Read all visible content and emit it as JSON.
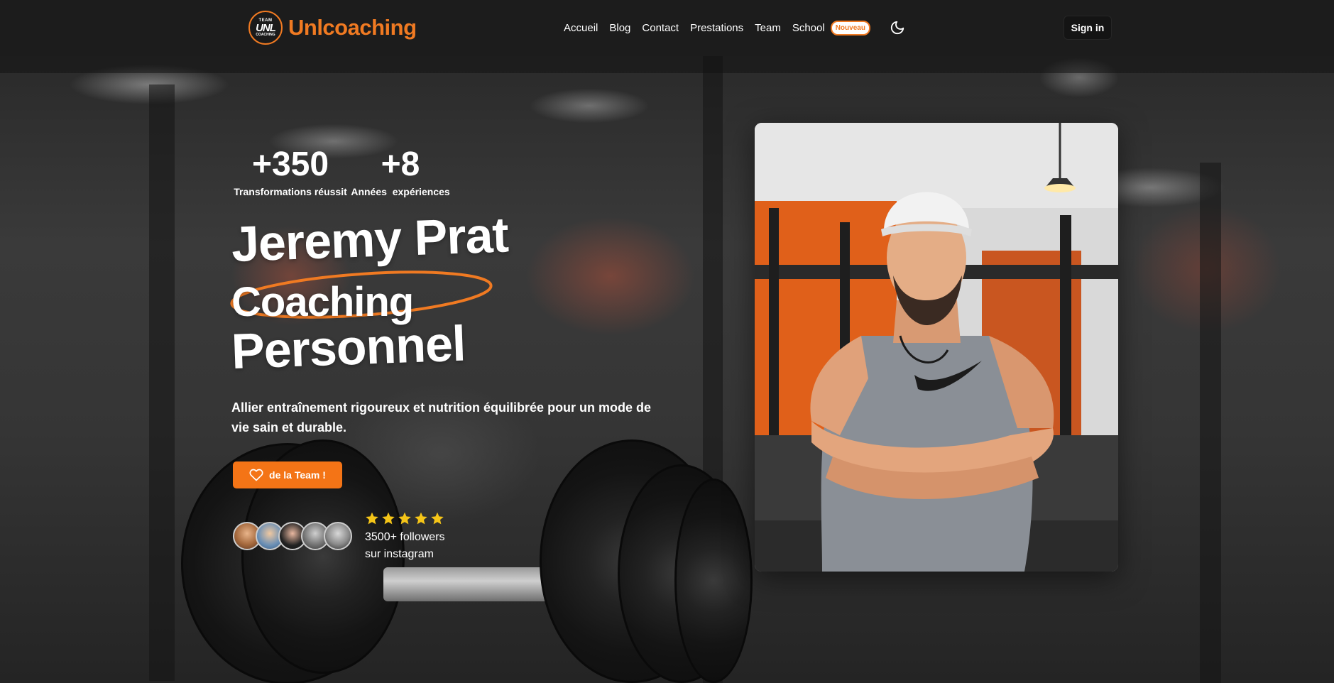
{
  "brand": {
    "name": "Unlcoaching",
    "badge_lines": [
      "TEAM",
      "UNL",
      "COACHING"
    ],
    "accent": "#f07a22"
  },
  "nav": {
    "links": [
      "Accueil",
      "Blog",
      "Contact",
      "Prestations",
      "Team",
      "School"
    ],
    "school_badge": "Nouveau",
    "theme_icon": "moon-icon",
    "signin_label": "Sign in"
  },
  "stats": [
    {
      "value": "+350",
      "label": "Transformations réussit"
    },
    {
      "value": "+8",
      "label": "Années  expériences"
    }
  ],
  "hero": {
    "title_line1": "Jeremy Prat",
    "title_line2": "Coaching",
    "title_line3": "Personnel",
    "subtitle": "Allier entraînement rigoureux et nutrition équilibrée pour un mode de vie sain et durable.",
    "cta_label": "de la Team !",
    "cta_icon": "heart-icon",
    "cta_color": "#f47416"
  },
  "social": {
    "rating_stars": 5,
    "star_color": "#f5c518",
    "followers_line1": "3500+ followers",
    "followers_line2": "sur instagram",
    "avatar_count": 5
  }
}
